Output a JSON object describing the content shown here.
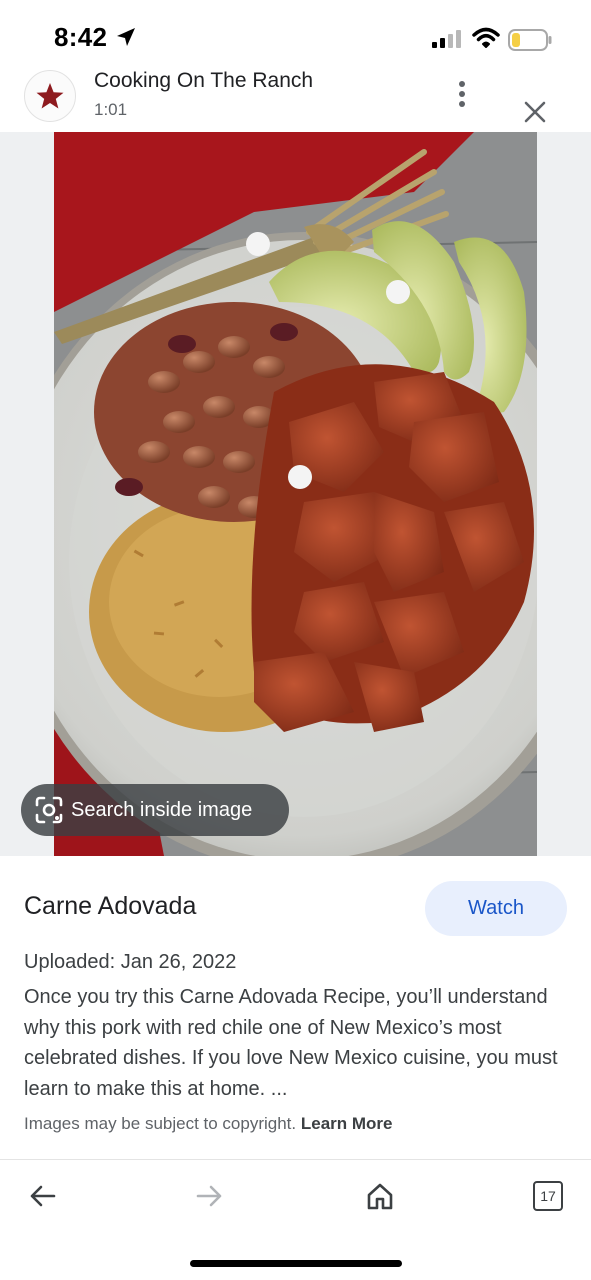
{
  "status_bar": {
    "time": "8:42",
    "battery_color": "#f5cf46"
  },
  "header": {
    "channel_name": "Cooking On The Ranch",
    "duration": "1:01",
    "avatar_icon": "red-star-logo"
  },
  "image": {
    "lens_label": "Search inside image",
    "lens_icon": "camera-search-icon"
  },
  "info": {
    "title": "Carne Adovada",
    "watch_label": "Watch",
    "uploaded": "Uploaded: Jan 26, 2022",
    "description": "Once you try this Carne Adovada Recipe, you’ll understand why this pork with red chile one of New Mexico’s most celebrated dishes. If you love New Mexico cuisine, you must learn to make this at home. ...",
    "copyright_text": "Images may be subject to copyright.",
    "learn_more": "Learn More"
  },
  "nav": {
    "tab_count": "17",
    "accent": "#1a56c8"
  }
}
